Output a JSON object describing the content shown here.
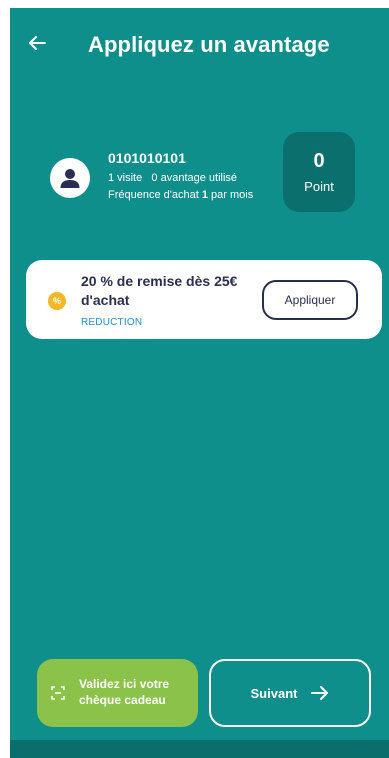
{
  "header": {
    "title": "Appliquez un avantage"
  },
  "customer": {
    "phone": "0101010101",
    "visits": "1 visite",
    "benefits_used": "0 avantage utilisé",
    "frequency_prefix": "Fréquence d'achat ",
    "frequency_count": "1",
    "frequency_suffix": " par mois"
  },
  "points": {
    "value": "0",
    "label": "Point"
  },
  "offer": {
    "icon_symbol": "%",
    "title": "20 % de remise dès 25€ d'achat",
    "type": "REDUCTION",
    "apply_label": "Appliquer"
  },
  "footer": {
    "gift_label": "Validez ici votre chèque cadeau",
    "next_label": "Suivant"
  },
  "colors": {
    "background": "#0f8f8c",
    "points_box": "#0b6f6d",
    "gift_button": "#8bc34a",
    "offer_icon": "#f4b826",
    "offer_type": "#1e8fe6",
    "dark_text": "#2a2e53"
  },
  "icons": {
    "back": "arrow-left-icon",
    "avatar": "user-icon",
    "offer": "percent-badge-icon",
    "gift": "scan-frame-icon",
    "next": "arrow-right-icon"
  }
}
